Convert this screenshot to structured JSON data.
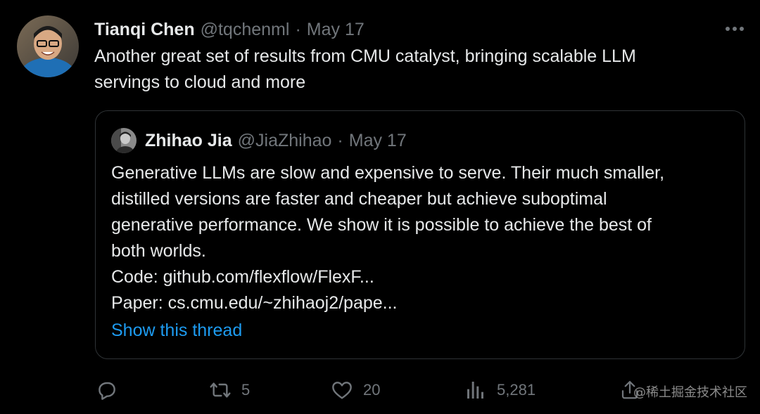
{
  "tweet": {
    "author_name": "Tianqi Chen",
    "author_handle": "@tqchenml",
    "separator": "·",
    "date": "May 17",
    "text": "Another great set of results from CMU catalyst, bringing scalable LLM\nservings to cloud and more",
    "more_icon": "more-horizontal-icon"
  },
  "quote": {
    "author_name": "Zhihao Jia",
    "author_handle": "@JiaZhihao",
    "separator": "·",
    "date": "May 17",
    "text": "Generative LLMs are slow and expensive to serve. Their much smaller,\ndistilled versions are faster and cheaper but achieve suboptimal\ngenerative performance. We show it is possible to achieve the best of\nboth worlds.\nCode: github.com/flexflow/FlexF...\nPaper: cs.cmu.edu/~zhihaoj2/pape...",
    "show_thread": "Show this thread"
  },
  "actions": {
    "reply_icon": "reply-icon",
    "retweet_icon": "retweet-icon",
    "retweet_count": "5",
    "like_icon": "heart-icon",
    "like_count": "20",
    "views_icon": "views-chart-icon",
    "views_count": "5,281",
    "share_icon": "share-icon"
  },
  "watermark": "@稀土掘金技术社区",
  "colors": {
    "background": "#000000",
    "text": "#e7e9ea",
    "muted": "#71767b",
    "link": "#1d9bf0",
    "border": "#2f3336"
  }
}
